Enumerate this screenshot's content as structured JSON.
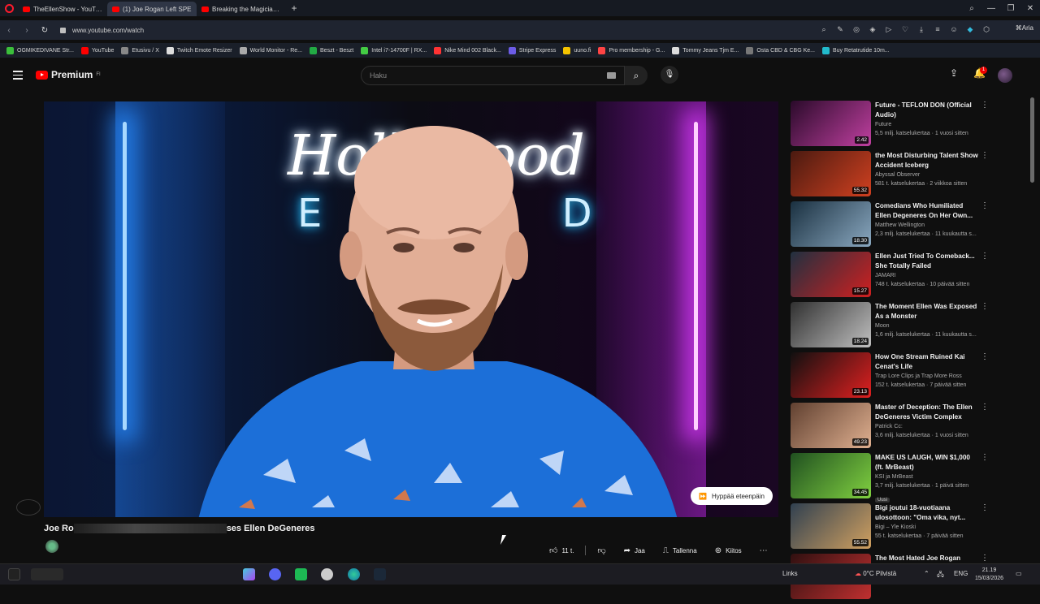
{
  "browser": {
    "tabs": [
      {
        "label": "TheEllenShow - YouTube",
        "active": false
      },
      {
        "label": "(1) Joe Rogan Left SPE",
        "active": true
      },
      {
        "label": "Breaking the Magician's C",
        "active": false
      }
    ],
    "url": "www.youtube.com/watch",
    "aria_label": "Aria",
    "bookmarks": [
      {
        "label": "OGMIKEDIVANE Str...",
        "color": "#3bbf3b"
      },
      {
        "label": "YouTube",
        "color": "#ff0000"
      },
      {
        "label": "Etusivu / X",
        "color": "#888888"
      },
      {
        "label": "Twitch Emote Resizer",
        "color": "#dddddd"
      },
      {
        "label": "World Monitor - Re...",
        "color": "#aaaaaa"
      },
      {
        "label": "Beszt - Beszt",
        "color": "#22aa44"
      },
      {
        "label": "Intel i7-14700F | RX...",
        "color": "#44cc44"
      },
      {
        "label": "Nike Mind 002 Black...",
        "color": "#ff3333"
      },
      {
        "label": "Stripe Express",
        "color": "#6c5ce7"
      },
      {
        "label": "uuno.fi",
        "color": "#f5c400"
      },
      {
        "label": "Pro membership - G...",
        "color": "#ff4444"
      },
      {
        "label": "Tommy Jeans Tjm E...",
        "color": "#dddddd"
      },
      {
        "label": "Osta CBD & CBG Ke...",
        "color": "#777777"
      },
      {
        "label": "Buy Retatrutide 10m...",
        "color": "#22bbcc"
      }
    ]
  },
  "youtube": {
    "logo_text": "Premium",
    "logo_sup": "FI",
    "search_placeholder": "Haku",
    "notification_count": "1",
    "video": {
      "sign_line1": "Hollywood",
      "sign_line2": "E D",
      "skip_label": "Hyppää eteenpäin",
      "title_start": "Joe Ro",
      "title_end": "ses Ellen DeGeneres",
      "likes": "11 t.",
      "share_label": "Jaa",
      "save_label": "Tallenna",
      "thanks_label": "Kiitos"
    },
    "recommendations": [
      {
        "title": "Future - TEFLON DON (Official Audio)",
        "channel": "Future",
        "info": "5,5 milj. katselukertaa · 1 vuosi sitten",
        "duration": "2.42",
        "thumb": [
          "#2a0a2a",
          "#c040a0"
        ]
      },
      {
        "title": "the Most Disturbing Talent Show Accident Iceberg",
        "channel": "Abyssal Observer",
        "info": "581 t. katselukertaa · 2 viikkoa sitten",
        "duration": "55.32",
        "thumb": [
          "#4a1a10",
          "#d04020"
        ]
      },
      {
        "title": "Comedians Who Humiliated Ellen Degeneres On Her Own...",
        "channel": "Matthew Wellington",
        "info": "2,3 milj. katselukertaa · 11 kuukautta s...",
        "duration": "18.30",
        "thumb": [
          "#1a3040",
          "#8aa8c0"
        ]
      },
      {
        "title": "Ellen Just Tried To Comeback... She Totally Failed",
        "channel": "JAMARI",
        "info": "748 t. katselukertaa · 10 päivää sitten",
        "duration": "15.27",
        "thumb": [
          "#203040",
          "#d02020"
        ]
      },
      {
        "title": "The Moment Ellen Was Exposed As a Monster",
        "channel": "Moon",
        "info": "1,6 milj. katselukertaa · 11 kuukautta s...",
        "duration": "18.24",
        "thumb": [
          "#303030",
          "#c0c0c0"
        ]
      },
      {
        "title": "How One Stream Ruined Kai Cenat's Life",
        "channel": "Trap Lore Clips ja Trap More Ross",
        "info": "152 t. katselukertaa · 7 päivää sitten",
        "duration": "23.13",
        "thumb": [
          "#101010",
          "#e02020"
        ]
      },
      {
        "title": "Master of Deception: The Ellen DeGeneres Victim Complex",
        "channel": "Patrick Cc:",
        "info": "3,6 milj. katselukertaa · 1 vuosi sitten",
        "duration": "49.23",
        "thumb": [
          "#604030",
          "#e0b090"
        ]
      },
      {
        "title": "MAKE US LAUGH, WIN $1,000 (ft. MrBeast)",
        "channel": "KSI ja MrBeast",
        "info": "3,7 milj. katselukertaa · 1 päivä sitten",
        "duration": "34.45",
        "tag": "Uusi",
        "thumb": [
          "#205020",
          "#80d040"
        ]
      },
      {
        "title": "Bigi joutui 18-vuotiaana ulosottoon: \"Oma vika, nyt...",
        "channel": "Bigi – Yle Kioski",
        "info": "55 t. katselukertaa · 7 päivää sitten",
        "duration": "55.52",
        "thumb": [
          "#304050",
          "#d0a060"
        ]
      },
      {
        "title": "The Most Hated Joe Rogan",
        "channel": "",
        "info": "",
        "duration": "",
        "thumb": [
          "#301010",
          "#c03030"
        ]
      }
    ]
  },
  "taskbar": {
    "links_label": "Links",
    "weather": "0°C Pilvistä",
    "lang": "ENG",
    "time": "21.19",
    "date": "15/03/2026"
  }
}
